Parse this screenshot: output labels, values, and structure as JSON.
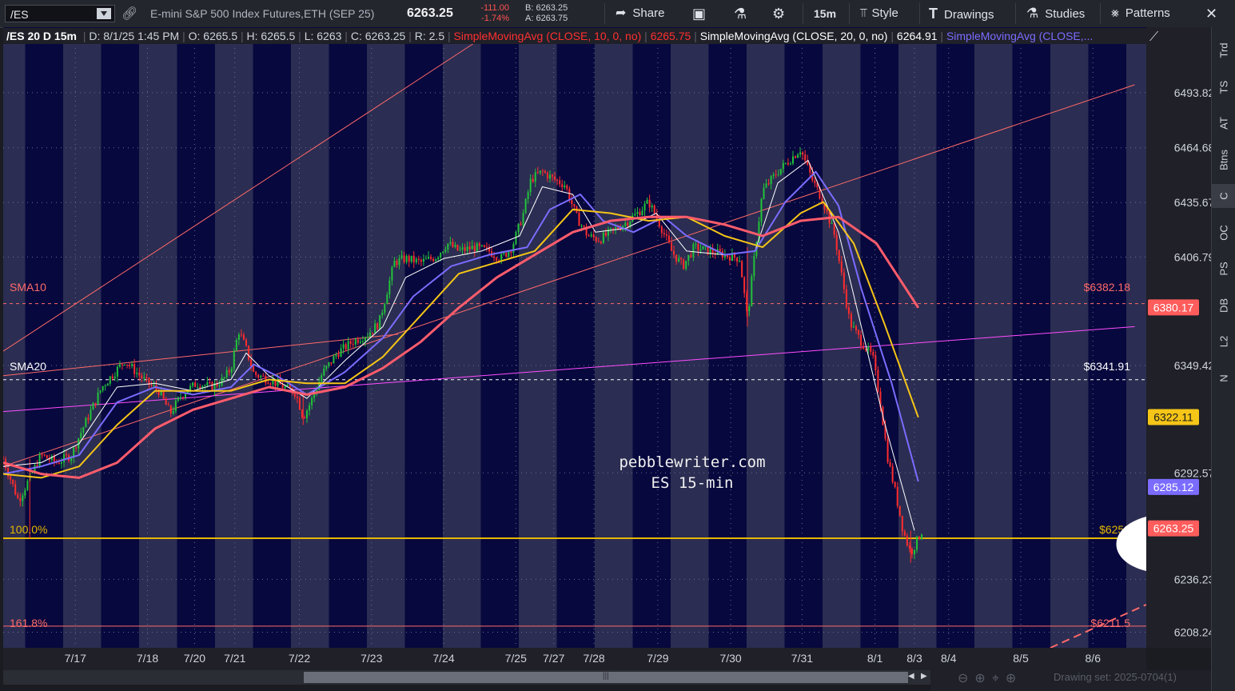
{
  "toolbar": {
    "symbol": "/ES",
    "description": "E-mini S&P 500 Index Futures,ETH (SEP 25)",
    "last": "6263.25",
    "change": "-111.00",
    "change_pct": "-1.74%",
    "bid": "B: 6263.25",
    "ask": "A: 6263.75",
    "share": "Share",
    "timeframe": "15m",
    "style": "Style",
    "drawings": "Drawings",
    "studies": "Studies",
    "patterns": "Patterns"
  },
  "legend": {
    "title": "/ES 20 D 15m",
    "date": "D: 8/1/25 1:45 PM",
    "open": "O: 6265.5",
    "high": "H: 6265.5",
    "low": "L: 6263",
    "close": "C: 6263.25",
    "range": "R: 2.5",
    "sma10_label": "SimpleMovingAvg (CLOSE, 10, 0, no)",
    "sma10_value": "6265.75",
    "sma20_label": "SimpleMovingAvg (CLOSE, 20, 0, no)",
    "sma20_value": "6264.91",
    "sma3_label": "SimpleMovingAvg (CLOSE,..."
  },
  "annotations": {
    "sma10": "SMA10",
    "sma10_price": "$6382.18",
    "sma20": "SMA20",
    "sma20_price": "$6341.91",
    "fib100": "100.0%",
    "fib100_price": "$6258",
    "fib161": "161.8%",
    "fib161_price": "$6211.5",
    "watermark1": "pebblewriter.com",
    "watermark2": "ES 15-min"
  },
  "price_axis": {
    "ticks": [
      "6493.82",
      "6464.68",
      "6435.67",
      "6406.79",
      "6349.42",
      "6292.57",
      "6236.23",
      "6208.24"
    ],
    "tags": [
      {
        "label": "6380.17",
        "price": 6380.17,
        "color": "#ff5c5c"
      },
      {
        "label": "6322.11",
        "price": 6322.11,
        "color": "#f5c518"
      },
      {
        "label": "6285.12",
        "price": 6285.12,
        "color": "#7b6cff"
      },
      {
        "label": "6263.25",
        "price": 6263.25,
        "color": "#ff5c5c"
      }
    ]
  },
  "date_axis": {
    "labels": [
      {
        "label": "7/17",
        "day": 0.95
      },
      {
        "label": "7/18",
        "day": 1.9
      },
      {
        "label": "7/20",
        "day": 2.52
      },
      {
        "label": "7/21",
        "day": 3.05
      },
      {
        "label": "7/22",
        "day": 3.9
      },
      {
        "label": "7/23",
        "day": 4.85
      },
      {
        "label": "7/24",
        "day": 5.8
      },
      {
        "label": "7/25",
        "day": 6.75
      },
      {
        "label": "7/27",
        "day": 7.25
      },
      {
        "label": "7/28",
        "day": 7.78
      },
      {
        "label": "7/29",
        "day": 8.62
      },
      {
        "label": "7/30",
        "day": 9.58
      },
      {
        "label": "7/31",
        "day": 10.52
      },
      {
        "label": "8/1",
        "day": 11.48
      },
      {
        "label": "8/3",
        "day": 12.0
      },
      {
        "label": "8/4",
        "day": 12.45
      },
      {
        "label": "8/5",
        "day": 13.4
      },
      {
        "label": "8/6",
        "day": 14.35
      }
    ]
  },
  "right_tabs": [
    "Trd",
    "TS",
    "AT",
    "Btns",
    "C",
    "OC",
    "PS",
    "DB",
    "L2",
    "N"
  ],
  "bottom": {
    "drawing_set": "Drawing set: 2025-0704(1)"
  },
  "chart_data": {
    "type": "candlestick",
    "y_range": [
      6200,
      6520
    ],
    "price_points": [
      [
        0,
        6300
      ],
      [
        0.2,
        6278
      ],
      [
        0.35,
        6290
      ],
      [
        0.5,
        6302
      ],
      [
        0.7,
        6298
      ],
      [
        0.9,
        6302
      ],
      [
        1.0,
        6312
      ],
      [
        1.15,
        6325
      ],
      [
        1.3,
        6338
      ],
      [
        1.45,
        6345
      ],
      [
        1.6,
        6352
      ],
      [
        1.75,
        6346
      ],
      [
        1.9,
        6340
      ],
      [
        2.05,
        6336
      ],
      [
        2.2,
        6324
      ],
      [
        2.35,
        6334
      ],
      [
        2.55,
        6340
      ],
      [
        2.75,
        6338
      ],
      [
        2.9,
        6342
      ],
      [
        3.0,
        6348
      ],
      [
        3.1,
        6368
      ],
      [
        3.2,
        6358
      ],
      [
        3.3,
        6345
      ],
      [
        3.5,
        6342
      ],
      [
        3.7,
        6338
      ],
      [
        3.85,
        6335
      ],
      [
        3.95,
        6322
      ],
      [
        4.05,
        6330
      ],
      [
        4.2,
        6345
      ],
      [
        4.4,
        6356
      ],
      [
        4.6,
        6362
      ],
      [
        4.8,
        6366
      ],
      [
        4.95,
        6372
      ],
      [
        5.05,
        6388
      ],
      [
        5.15,
        6404
      ],
      [
        5.3,
        6406
      ],
      [
        5.5,
        6404
      ],
      [
        5.7,
        6407
      ],
      [
        5.85,
        6414
      ],
      [
        6.0,
        6410
      ],
      [
        6.2,
        6412
      ],
      [
        6.4,
        6410
      ],
      [
        6.55,
        6406
      ],
      [
        6.7,
        6412
      ],
      [
        6.85,
        6430
      ],
      [
        6.95,
        6448
      ],
      [
        7.1,
        6452
      ],
      [
        7.25,
        6448
      ],
      [
        7.4,
        6445
      ],
      [
        7.55,
        6428
      ],
      [
        7.7,
        6418
      ],
      [
        7.85,
        6416
      ],
      [
        8.0,
        6420
      ],
      [
        8.2,
        6425
      ],
      [
        8.35,
        6430
      ],
      [
        8.5,
        6436
      ],
      [
        8.65,
        6424
      ],
      [
        8.8,
        6410
      ],
      [
        8.95,
        6402
      ],
      [
        9.1,
        6412
      ],
      [
        9.3,
        6410
      ],
      [
        9.5,
        6408
      ],
      [
        9.7,
        6406
      ],
      [
        9.8,
        6374
      ],
      [
        9.9,
        6410
      ],
      [
        10.0,
        6442
      ],
      [
        10.2,
        6452
      ],
      [
        10.35,
        6458
      ],
      [
        10.5,
        6464
      ],
      [
        10.65,
        6448
      ],
      [
        10.8,
        6436
      ],
      [
        10.95,
        6418
      ],
      [
        11.05,
        6395
      ],
      [
        11.15,
        6372
      ],
      [
        11.3,
        6362
      ],
      [
        11.45,
        6354
      ],
      [
        11.55,
        6330
      ],
      [
        11.65,
        6300
      ],
      [
        11.75,
        6282
      ],
      [
        11.85,
        6262
      ],
      [
        11.95,
        6250
      ],
      [
        12.05,
        6258
      ],
      [
        12.1,
        6262
      ]
    ],
    "sma10_points": [
      [
        0,
        6296
      ],
      [
        0.5,
        6298
      ],
      [
        1.0,
        6308
      ],
      [
        1.5,
        6338
      ],
      [
        2.0,
        6340
      ],
      [
        2.5,
        6336
      ],
      [
        3.0,
        6342
      ],
      [
        3.2,
        6356
      ],
      [
        3.5,
        6344
      ],
      [
        4.0,
        6332
      ],
      [
        4.5,
        6352
      ],
      [
        5.0,
        6370
      ],
      [
        5.3,
        6396
      ],
      [
        5.8,
        6406
      ],
      [
        6.3,
        6410
      ],
      [
        6.8,
        6418
      ],
      [
        7.1,
        6444
      ],
      [
        7.5,
        6440
      ],
      [
        7.8,
        6420
      ],
      [
        8.2,
        6422
      ],
      [
        8.6,
        6430
      ],
      [
        9.0,
        6410
      ],
      [
        9.5,
        6408
      ],
      [
        9.9,
        6410
      ],
      [
        10.2,
        6446
      ],
      [
        10.6,
        6458
      ],
      [
        11.0,
        6420
      ],
      [
        11.3,
        6370
      ],
      [
        11.6,
        6320
      ],
      [
        12.0,
        6262
      ]
    ],
    "sma20_points": [
      [
        0,
        6292
      ],
      [
        0.5,
        6296
      ],
      [
        1.0,
        6302
      ],
      [
        1.5,
        6330
      ],
      [
        2.0,
        6338
      ],
      [
        2.5,
        6334
      ],
      [
        3.0,
        6338
      ],
      [
        3.3,
        6350
      ],
      [
        3.6,
        6344
      ],
      [
        4.0,
        6334
      ],
      [
        4.5,
        6346
      ],
      [
        5.0,
        6364
      ],
      [
        5.4,
        6386
      ],
      [
        5.9,
        6402
      ],
      [
        6.4,
        6408
      ],
      [
        6.9,
        6412
      ],
      [
        7.2,
        6432
      ],
      [
        7.6,
        6440
      ],
      [
        7.9,
        6426
      ],
      [
        8.3,
        6420
      ],
      [
        8.7,
        6428
      ],
      [
        9.0,
        6418
      ],
      [
        9.5,
        6408
      ],
      [
        9.9,
        6410
      ],
      [
        10.3,
        6436
      ],
      [
        10.7,
        6452
      ],
      [
        11.0,
        6434
      ],
      [
        11.3,
        6390
      ],
      [
        11.7,
        6340
      ],
      [
        12.05,
        6288
      ]
    ],
    "sma50_points": [
      [
        0,
        6292
      ],
      [
        0.5,
        6290
      ],
      [
        1.0,
        6296
      ],
      [
        1.5,
        6318
      ],
      [
        2.0,
        6336
      ],
      [
        2.5,
        6336
      ],
      [
        3.0,
        6336
      ],
      [
        3.5,
        6342
      ],
      [
        4.0,
        6340
      ],
      [
        4.5,
        6340
      ],
      [
        5.0,
        6354
      ],
      [
        5.5,
        6376
      ],
      [
        6.0,
        6398
      ],
      [
        6.5,
        6404
      ],
      [
        7.0,
        6410
      ],
      [
        7.5,
        6432
      ],
      [
        8.0,
        6430
      ],
      [
        8.5,
        6426
      ],
      [
        9.0,
        6428
      ],
      [
        9.5,
        6418
      ],
      [
        10.0,
        6412
      ],
      [
        10.5,
        6430
      ],
      [
        10.8,
        6436
      ],
      [
        11.2,
        6414
      ],
      [
        11.6,
        6372
      ],
      [
        12.05,
        6322
      ]
    ],
    "sma100_points": [
      [
        0,
        6298
      ],
      [
        0.5,
        6292
      ],
      [
        1.0,
        6290
      ],
      [
        1.5,
        6298
      ],
      [
        2.0,
        6316
      ],
      [
        2.5,
        6326
      ],
      [
        3.0,
        6332
      ],
      [
        3.5,
        6338
      ],
      [
        4.0,
        6334
      ],
      [
        4.5,
        6338
      ],
      [
        5.0,
        6348
      ],
      [
        5.5,
        6362
      ],
      [
        6.0,
        6380
      ],
      [
        6.5,
        6396
      ],
      [
        7.0,
        6408
      ],
      [
        7.5,
        6420
      ],
      [
        8.0,
        6426
      ],
      [
        8.5,
        6428
      ],
      [
        9.0,
        6428
      ],
      [
        9.5,
        6424
      ],
      [
        10.0,
        6418
      ],
      [
        10.5,
        6426
      ],
      [
        11.0,
        6428
      ],
      [
        11.5,
        6414
      ],
      [
        12.05,
        6380
      ]
    ],
    "levels": [
      {
        "price": 6382.18,
        "color": "#ff6a6a",
        "style": "dashed"
      },
      {
        "price": 6341.91,
        "color": "#ffffff",
        "style": "dashed"
      },
      {
        "price": 6258,
        "color": "#e6b800",
        "style": "solid"
      },
      {
        "price": 6211.5,
        "color": "#ff6a6a",
        "style": "solid"
      }
    ],
    "trendlines": [
      {
        "p1": [
          0,
          6357
        ],
        "p2": [
          6.2,
          6520
        ],
        "color": "#ff6a6a"
      },
      {
        "p1": [
          0,
          6344
        ],
        "p2": [
          5.2,
          6366
        ],
        "color": "#ff6a6a"
      },
      {
        "p1": [
          0,
          6296
        ],
        "p2": [
          14.9,
          6498
        ],
        "color": "#ff6a6a"
      },
      {
        "p1": [
          0,
          6325
        ],
        "p2": [
          14.9,
          6370
        ],
        "color": "#ff4dff"
      }
    ]
  }
}
